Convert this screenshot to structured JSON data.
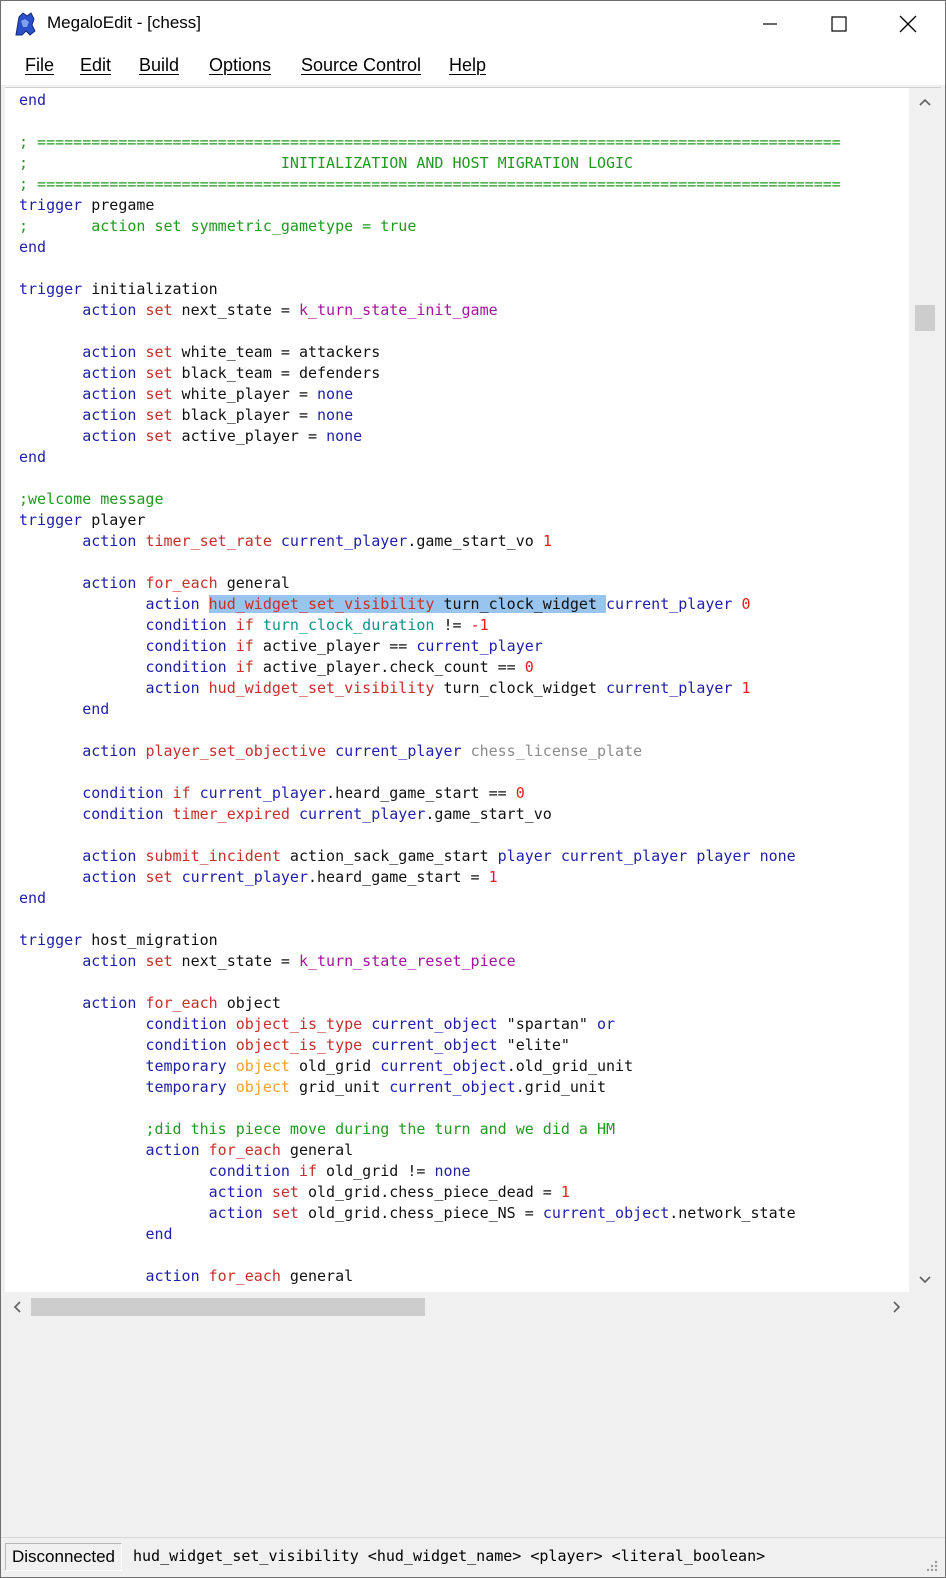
{
  "window": {
    "title": "MegaloEdit - [chess]",
    "icon": "megalo-app-icon"
  },
  "menu": [
    {
      "label": "File"
    },
    {
      "label": "Edit"
    },
    {
      "label": "Build"
    },
    {
      "label": "Options"
    },
    {
      "label": "Source Control"
    },
    {
      "label": "Help"
    }
  ],
  "colors": {
    "keyword": "#1f1fa8",
    "function": "#c4302a",
    "constant": "#a1159d",
    "number": "#ea1c1c",
    "comment": "#209a20",
    "teal": "#149189",
    "gray": "#8c8c8c",
    "orange": "#f0a030",
    "selection": "#99c4ee"
  },
  "editor": {
    "lines": [
      [
        [
          "end",
          "kw"
        ]
      ],
      [],
      [
        [
          "; =========================================================================================",
          "green"
        ]
      ],
      [
        [
          ";                            INITIALIZATION AND HOST MIGRATION LOGIC",
          "green"
        ]
      ],
      [
        [
          "; =========================================================================================",
          "green"
        ]
      ],
      [
        [
          "trigger",
          "kw"
        ],
        [
          " pregame",
          "plain"
        ]
      ],
      [
        [
          ";       action set symmetric_gametype = true",
          "green"
        ]
      ],
      [
        [
          "end",
          "kw"
        ]
      ],
      [],
      [
        [
          "trigger",
          "kw"
        ],
        [
          " initialization",
          "plain"
        ]
      ],
      [
        [
          "       ",
          "plain"
        ],
        [
          "action",
          "kw"
        ],
        [
          " ",
          "plain"
        ],
        [
          "set",
          "fn"
        ],
        [
          " next_state = ",
          "plain"
        ],
        [
          "k_turn_state_init_game",
          "purple"
        ]
      ],
      [],
      [
        [
          "       ",
          "plain"
        ],
        [
          "action",
          "kw"
        ],
        [
          " ",
          "plain"
        ],
        [
          "set",
          "fn"
        ],
        [
          " white_team = attackers",
          "plain"
        ]
      ],
      [
        [
          "       ",
          "plain"
        ],
        [
          "action",
          "kw"
        ],
        [
          " ",
          "plain"
        ],
        [
          "set",
          "fn"
        ],
        [
          " black_team = defenders",
          "plain"
        ]
      ],
      [
        [
          "       ",
          "plain"
        ],
        [
          "action",
          "kw"
        ],
        [
          " ",
          "plain"
        ],
        [
          "set",
          "fn"
        ],
        [
          " white_player = ",
          "plain"
        ],
        [
          "none",
          "kw"
        ]
      ],
      [
        [
          "       ",
          "plain"
        ],
        [
          "action",
          "kw"
        ],
        [
          " ",
          "plain"
        ],
        [
          "set",
          "fn"
        ],
        [
          " black_player = ",
          "plain"
        ],
        [
          "none",
          "kw"
        ]
      ],
      [
        [
          "       ",
          "plain"
        ],
        [
          "action",
          "kw"
        ],
        [
          " ",
          "plain"
        ],
        [
          "set",
          "fn"
        ],
        [
          " active_player = ",
          "plain"
        ],
        [
          "none",
          "kw"
        ]
      ],
      [
        [
          "end",
          "kw"
        ]
      ],
      [],
      [
        [
          ";welcome message",
          "green"
        ]
      ],
      [
        [
          "trigger",
          "kw"
        ],
        [
          " player",
          "plain"
        ]
      ],
      [
        [
          "       ",
          "plain"
        ],
        [
          "action",
          "kw"
        ],
        [
          " ",
          "plain"
        ],
        [
          "timer_set_rate",
          "fn"
        ],
        [
          " ",
          "plain"
        ],
        [
          "current_player",
          "kw"
        ],
        [
          ".game_start_vo ",
          "plain"
        ],
        [
          "1",
          "num"
        ]
      ],
      [],
      [
        [
          "       ",
          "plain"
        ],
        [
          "action",
          "kw"
        ],
        [
          " ",
          "plain"
        ],
        [
          "for_each",
          "fn"
        ],
        [
          " general",
          "plain"
        ]
      ],
      [
        [
          "              ",
          "plain"
        ],
        [
          "action",
          "kw"
        ],
        [
          " ",
          "plain"
        ],
        [
          "hud_widget_set_visibility",
          "fn",
          "sel"
        ],
        [
          " turn_clock_widget ",
          "plain",
          "sel"
        ],
        [
          "current_player",
          "kw"
        ],
        [
          " ",
          "plain"
        ],
        [
          "0",
          "num"
        ]
      ],
      [
        [
          "              ",
          "plain"
        ],
        [
          "condition",
          "kw"
        ],
        [
          " ",
          "plain"
        ],
        [
          "if",
          "fn"
        ],
        [
          " ",
          "plain"
        ],
        [
          "turn_clock_duration",
          "teal"
        ],
        [
          " != ",
          "plain"
        ],
        [
          "-1",
          "num"
        ]
      ],
      [
        [
          "              ",
          "plain"
        ],
        [
          "condition",
          "kw"
        ],
        [
          " ",
          "plain"
        ],
        [
          "if",
          "fn"
        ],
        [
          " active_player == ",
          "plain"
        ],
        [
          "current_player",
          "kw"
        ]
      ],
      [
        [
          "              ",
          "plain"
        ],
        [
          "condition",
          "kw"
        ],
        [
          " ",
          "plain"
        ],
        [
          "if",
          "fn"
        ],
        [
          " active_player.check_count == ",
          "plain"
        ],
        [
          "0",
          "num"
        ]
      ],
      [
        [
          "              ",
          "plain"
        ],
        [
          "action",
          "kw"
        ],
        [
          " ",
          "plain"
        ],
        [
          "hud_widget_set_visibility",
          "fn"
        ],
        [
          " turn_clock_widget ",
          "plain"
        ],
        [
          "current_player",
          "kw"
        ],
        [
          " ",
          "plain"
        ],
        [
          "1",
          "num"
        ]
      ],
      [
        [
          "       ",
          "plain"
        ],
        [
          "end",
          "kw"
        ]
      ],
      [],
      [
        [
          "       ",
          "plain"
        ],
        [
          "action",
          "kw"
        ],
        [
          " ",
          "plain"
        ],
        [
          "player_set_objective",
          "fn"
        ],
        [
          " ",
          "plain"
        ],
        [
          "current_player",
          "kw"
        ],
        [
          " ",
          "plain"
        ],
        [
          "chess_license_plate",
          "gray"
        ]
      ],
      [],
      [
        [
          "       ",
          "plain"
        ],
        [
          "condition",
          "kw"
        ],
        [
          " ",
          "plain"
        ],
        [
          "if",
          "fn"
        ],
        [
          " ",
          "plain"
        ],
        [
          "current_player",
          "kw"
        ],
        [
          ".heard_game_start == ",
          "plain"
        ],
        [
          "0",
          "num"
        ]
      ],
      [
        [
          "       ",
          "plain"
        ],
        [
          "condition",
          "kw"
        ],
        [
          " ",
          "plain"
        ],
        [
          "timer_expired",
          "fn"
        ],
        [
          " ",
          "plain"
        ],
        [
          "current_player",
          "kw"
        ],
        [
          ".game_start_vo",
          "plain"
        ]
      ],
      [],
      [
        [
          "       ",
          "plain"
        ],
        [
          "action",
          "kw"
        ],
        [
          " ",
          "plain"
        ],
        [
          "submit_incident",
          "fn"
        ],
        [
          " action_sack_game_start ",
          "plain"
        ],
        [
          "player",
          "kw"
        ],
        [
          " ",
          "plain"
        ],
        [
          "current_player",
          "kw"
        ],
        [
          " ",
          "plain"
        ],
        [
          "player",
          "kw"
        ],
        [
          " ",
          "plain"
        ],
        [
          "none",
          "kw"
        ]
      ],
      [
        [
          "       ",
          "plain"
        ],
        [
          "action",
          "kw"
        ],
        [
          " ",
          "plain"
        ],
        [
          "set",
          "fn"
        ],
        [
          " ",
          "plain"
        ],
        [
          "current_player",
          "kw"
        ],
        [
          ".heard_game_start = ",
          "plain"
        ],
        [
          "1",
          "num"
        ]
      ],
      [
        [
          "end",
          "kw"
        ]
      ],
      [],
      [
        [
          "trigger",
          "kw"
        ],
        [
          " host_migration",
          "plain"
        ]
      ],
      [
        [
          "       ",
          "plain"
        ],
        [
          "action",
          "kw"
        ],
        [
          " ",
          "plain"
        ],
        [
          "set",
          "fn"
        ],
        [
          " next_state = ",
          "plain"
        ],
        [
          "k_turn_state_reset_piece",
          "purple"
        ]
      ],
      [],
      [
        [
          "       ",
          "plain"
        ],
        [
          "action",
          "kw"
        ],
        [
          " ",
          "plain"
        ],
        [
          "for_each",
          "fn"
        ],
        [
          " object",
          "plain"
        ]
      ],
      [
        [
          "              ",
          "plain"
        ],
        [
          "condition",
          "kw"
        ],
        [
          " ",
          "plain"
        ],
        [
          "object_is_type",
          "fn"
        ],
        [
          " ",
          "plain"
        ],
        [
          "current_object",
          "kw"
        ],
        [
          " \"spartan\" ",
          "plain"
        ],
        [
          "or",
          "kw"
        ]
      ],
      [
        [
          "              ",
          "plain"
        ],
        [
          "condition",
          "kw"
        ],
        [
          " ",
          "plain"
        ],
        [
          "object_is_type",
          "fn"
        ],
        [
          " ",
          "plain"
        ],
        [
          "current_object",
          "kw"
        ],
        [
          " \"elite\"",
          "plain"
        ]
      ],
      [
        [
          "              ",
          "plain"
        ],
        [
          "temporary",
          "kw"
        ],
        [
          " ",
          "plain"
        ],
        [
          "object",
          "orange"
        ],
        [
          " old_grid ",
          "plain"
        ],
        [
          "current_object",
          "kw"
        ],
        [
          ".old_grid_unit",
          "plain"
        ]
      ],
      [
        [
          "              ",
          "plain"
        ],
        [
          "temporary",
          "kw"
        ],
        [
          " ",
          "plain"
        ],
        [
          "object",
          "orange"
        ],
        [
          " grid_unit ",
          "plain"
        ],
        [
          "current_object",
          "kw"
        ],
        [
          ".grid_unit",
          "plain"
        ]
      ],
      [],
      [
        [
          "              ",
          "plain"
        ],
        [
          ";did this piece move during the turn and we did a HM",
          "green"
        ]
      ],
      [
        [
          "              ",
          "plain"
        ],
        [
          "action",
          "kw"
        ],
        [
          " ",
          "plain"
        ],
        [
          "for_each",
          "fn"
        ],
        [
          " general",
          "plain"
        ]
      ],
      [
        [
          "                     ",
          "plain"
        ],
        [
          "condition",
          "kw"
        ],
        [
          " ",
          "plain"
        ],
        [
          "if",
          "fn"
        ],
        [
          " old_grid != ",
          "plain"
        ],
        [
          "none",
          "kw"
        ]
      ],
      [
        [
          "                     ",
          "plain"
        ],
        [
          "action",
          "kw"
        ],
        [
          " ",
          "plain"
        ],
        [
          "set",
          "fn"
        ],
        [
          " old_grid.chess_piece_dead = ",
          "plain"
        ],
        [
          "1",
          "num"
        ]
      ],
      [
        [
          "                     ",
          "plain"
        ],
        [
          "action",
          "kw"
        ],
        [
          " ",
          "plain"
        ],
        [
          "set",
          "fn"
        ],
        [
          " old_grid.chess_piece_NS = ",
          "plain"
        ],
        [
          "current_object",
          "kw"
        ],
        [
          ".network_state",
          "plain"
        ]
      ],
      [
        [
          "              ",
          "plain"
        ],
        [
          "end",
          "kw"
        ]
      ],
      [],
      [
        [
          "              ",
          "plain"
        ],
        [
          "action",
          "kw"
        ],
        [
          " ",
          "plain"
        ],
        [
          "for_each",
          "fn"
        ],
        [
          " general",
          "plain"
        ]
      ]
    ]
  },
  "scrollbars": {
    "vertical_position": 0.17,
    "horizontal_position": 0.0
  },
  "statusbar": {
    "connection": "Disconnected",
    "signature": "hud_widget_set_visibility <hud_widget_name> <player> <literal_boolean>"
  }
}
